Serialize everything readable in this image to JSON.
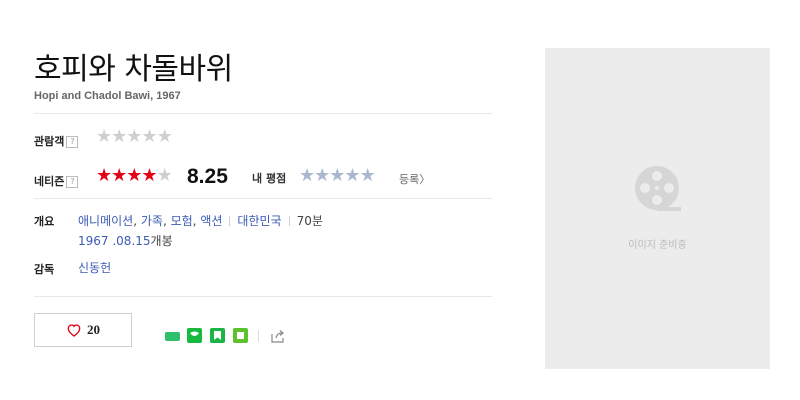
{
  "movie": {
    "title": "호피와 차돌바위",
    "subtitle": "Hopi and Chadol Bawi, 1967"
  },
  "ratings": {
    "audience_label": "관람객",
    "netizen_label": "네티즌",
    "help_mark": "?",
    "netizen_score": "8.25",
    "netizen_stars_filled": 4,
    "stars_total": 5,
    "my_rating_label": "내 평점",
    "register_label": "등록〉",
    "colors": {
      "star_on": "#e40017",
      "star_off": "#cfcfcf",
      "my_star": "#a9b7cf"
    }
  },
  "info": {
    "overview_label": "개요",
    "genres": [
      "애니메이션",
      "가족",
      "모험",
      "액션"
    ],
    "country": "대한민국",
    "runtime": "70분",
    "release_date": "1967 .08.15",
    "release_suffix": "개봉",
    "director_label": "감독",
    "director": "신동헌"
  },
  "actions": {
    "like_count": "20",
    "share_icons": [
      "band-icon",
      "line-icon",
      "bookmark-icon",
      "memo-icon",
      "share-out-icon"
    ]
  },
  "poster": {
    "placeholder_text": "이미지 준비중"
  }
}
